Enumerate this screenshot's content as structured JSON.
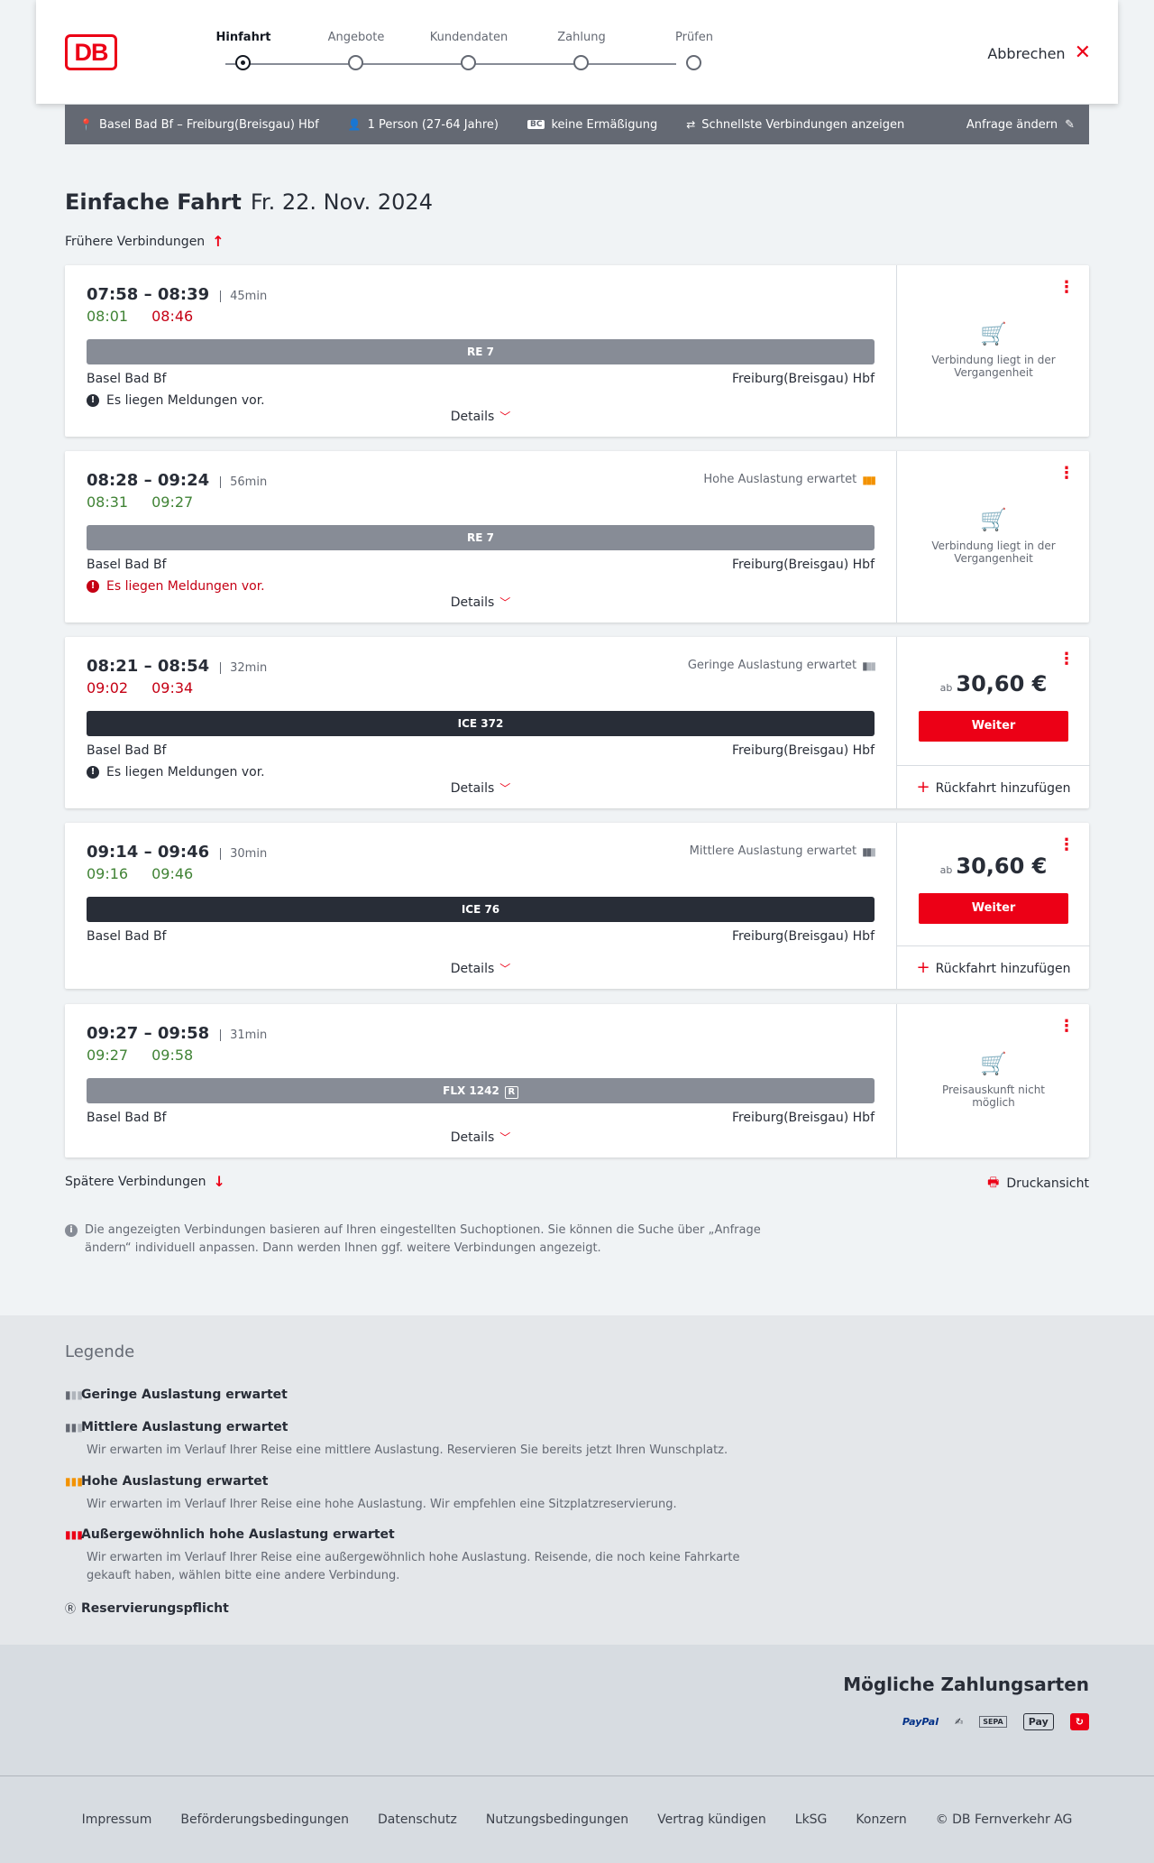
{
  "header": {
    "logo": "DB",
    "steps": [
      "Hinfahrt",
      "Angebote",
      "Kundendaten",
      "Zahlung",
      "Prüfen"
    ],
    "active_step": "Hinfahrt",
    "cancel_label": "Abbrechen"
  },
  "query": {
    "route": "Basel Bad Bf – Freiburg(Breisgau) Hbf",
    "persons": "1 Person (27-64 Jahre)",
    "discount_badge": "BC",
    "discount": "keine Ermäßigung",
    "fastest": "Schnellste Verbindungen anzeigen",
    "change": "Anfrage ändern"
  },
  "page": {
    "title_bold": "Einfache Fahrt",
    "title_date": "Fr. 22. Nov. 2024",
    "earlier": "Frühere Verbindungen",
    "later": "Spätere Verbindungen",
    "print": "Druckansicht",
    "details": "Details",
    "weiter": "Weiter",
    "price_prefix": "ab",
    "return_label": "Rückfahrt hinzufügen",
    "info": "Die angezeigten Verbindungen basieren auf Ihren eingestellten Suchoptionen. Sie können die Suche über „Anfrage ändern“ individuell anpassen. Dann werden Ihnen ggf. weitere Verbindungen angezeigt."
  },
  "connections": [
    {
      "times": "07:58 – 08:39",
      "duration": "45min",
      "rt_dep": "08:01",
      "rt_arr": "08:46",
      "train": "RE 7",
      "from": "Basel Bad Bf",
      "to": "Freiburg(Breisgau) Hbf",
      "message": "Es liegen Meldungen vor.",
      "status": "Verbindung liegt in der Vergangenheit"
    },
    {
      "times": "08:28 – 09:24",
      "duration": "56min",
      "rt_dep": "08:31",
      "rt_arr": "09:27",
      "occupancy": "Hohe Auslastung erwartet",
      "train": "RE 7",
      "from": "Basel Bad Bf",
      "to": "Freiburg(Breisgau) Hbf",
      "message": "Es liegen Meldungen vor.",
      "status": "Verbindung liegt in der Vergangenheit"
    },
    {
      "times": "08:21 – 08:54",
      "duration": "32min",
      "rt_dep": "09:02",
      "rt_arr": "09:34",
      "occupancy": "Geringe Auslastung erwartet",
      "train": "ICE 372",
      "from": "Basel Bad Bf",
      "to": "Freiburg(Breisgau) Hbf",
      "message": "Es liegen Meldungen vor.",
      "price": "30,60 €"
    },
    {
      "times": "09:14 – 09:46",
      "duration": "30min",
      "rt_dep": "09:16",
      "rt_arr": "09:46",
      "occupancy": "Mittlere Auslastung erwartet",
      "train": "ICE 76",
      "from": "Basel Bad Bf",
      "to": "Freiburg(Breisgau) Hbf",
      "price": "30,60 €"
    },
    {
      "times": "09:27 – 09:58",
      "duration": "31min",
      "rt_dep": "09:27",
      "rt_arr": "09:58",
      "train": "FLX 1242",
      "train_badge": "R",
      "from": "Basel Bad Bf",
      "to": "Freiburg(Breisgau) Hbf",
      "status": "Preisauskunft nicht möglich"
    }
  ],
  "legend": {
    "title": "Legende",
    "items": [
      {
        "title": "Geringe Auslastung erwartet"
      },
      {
        "title": "Mittlere Auslastung erwartet",
        "desc": "Wir erwarten im Verlauf Ihrer Reise eine mittlere Auslastung. Reservieren Sie bereits jetzt Ihren Wunschplatz."
      },
      {
        "title": "Hohe Auslastung erwartet",
        "desc": "Wir erwarten im Verlauf Ihrer Reise eine hohe Auslastung. Wir empfehlen eine Sitzplatzreservierung."
      },
      {
        "title": "Außergewöhnlich hohe Auslastung erwartet",
        "desc": "Wir erwarten im Verlauf Ihrer Reise eine außergewöhnlich hohe Auslastung. Reisende, die noch keine Fahrkarte gekauft haben, wählen bitte eine andere Verbindung."
      },
      {
        "title": "Reservierungspflicht"
      }
    ]
  },
  "payment": {
    "title": "Mögliche Zahlungsarten",
    "methods": [
      "PayPal",
      "SEPA",
      "Pay"
    ]
  },
  "footer": [
    "Impressum",
    "Beförderungsbedingungen",
    "Datenschutz",
    "Nutzungsbedingungen",
    "Vertrag kündigen",
    "LkSG",
    "Konzern",
    "© DB Fernverkehr AG"
  ],
  "colors": {
    "accent": "#ec0016",
    "green": "#408335",
    "red": "#c50014",
    "dark_bar": "#282d37",
    "grey_bar": "#878c96",
    "occupancy_high": "#f39200"
  }
}
